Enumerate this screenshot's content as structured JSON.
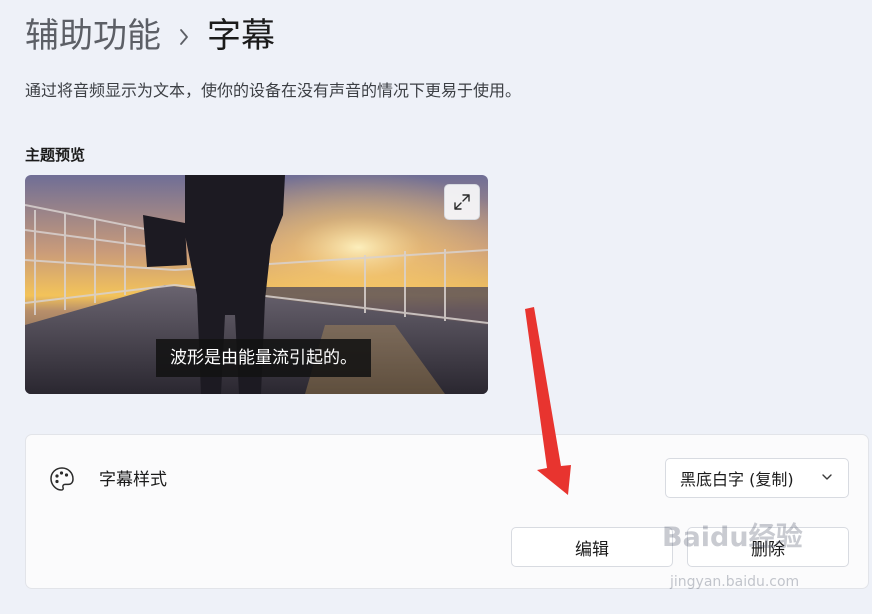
{
  "breadcrumb": {
    "parent": "辅助功能",
    "separator": "›",
    "current": "字幕"
  },
  "description": "通过将音频显示为文本，使你的设备在没有声音的情况下更易于使用。",
  "theme_preview": {
    "label": "主题预览",
    "caption": "波形是由能量流引起的。",
    "expand_icon": "expand-icon"
  },
  "caption_style": {
    "icon": "palette-icon",
    "label": "字幕样式",
    "selected": "黑底白字 (复制)",
    "dropdown_icon": "chevron-down-icon",
    "edit_button": "编辑",
    "delete_button": "删除"
  },
  "annotation": {
    "arrow_color": "#e8342f"
  },
  "watermark": {
    "logo_text": "Baidu经验",
    "url": "jingyan.baidu.com"
  }
}
